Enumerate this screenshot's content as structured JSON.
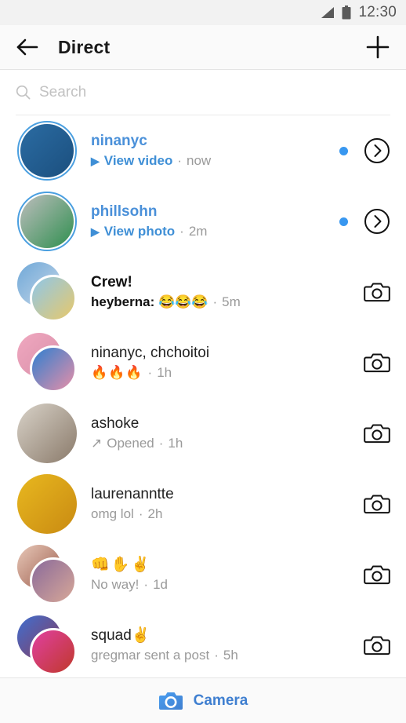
{
  "status_bar": {
    "time": "12:30",
    "signal_icon": "signal-triangle-icon",
    "battery_icon": "battery-icon"
  },
  "header": {
    "title": "Direct",
    "back_icon": "back-arrow-icon",
    "new_message_icon": "plus-icon"
  },
  "search": {
    "placeholder": "Search",
    "value": "",
    "icon": "search-icon"
  },
  "conversations": [
    {
      "name": "ninanyc",
      "name_style": "blue",
      "preview": "View video",
      "preview_style": "blue",
      "time": "now",
      "separator": "·",
      "media_icon": "play-triangle-icon",
      "avatar_type": "single-ring",
      "unread_dot": true,
      "action_icon": "chevron-right-circle-icon"
    },
    {
      "name": "phillsohn",
      "name_style": "blue",
      "preview": "View photo",
      "preview_style": "blue",
      "time": "2m",
      "separator": "·",
      "media_icon": "play-triangle-icon",
      "avatar_type": "single-ring",
      "unread_dot": true,
      "action_icon": "chevron-right-circle-icon"
    },
    {
      "name": "Crew!",
      "name_style": "unread",
      "preview": "heyberna: 😂😂😂",
      "preview_style": "unread",
      "time": "5m",
      "separator": "·",
      "avatar_type": "group",
      "unread_dot": false,
      "action_icon": "camera-outline-icon"
    },
    {
      "name": "ninanyc, chchoitoi",
      "name_style": "normal",
      "preview": "🔥🔥🔥",
      "preview_style": "emoji",
      "time": "1h",
      "separator": "·",
      "avatar_type": "group",
      "unread_dot": false,
      "action_icon": "camera-outline-icon"
    },
    {
      "name": "ashoke",
      "name_style": "normal",
      "preview": "Opened",
      "preview_style": "opened",
      "time": "1h",
      "separator": "·",
      "media_icon": "arrow-up-right-icon",
      "avatar_type": "single",
      "unread_dot": false,
      "action_icon": "camera-outline-icon"
    },
    {
      "name": "laurenanntte",
      "name_style": "normal",
      "preview": "omg lol",
      "preview_style": "normal",
      "time": "2h",
      "separator": "·",
      "avatar_type": "single",
      "unread_dot": false,
      "action_icon": "camera-outline-icon"
    },
    {
      "name": "👊✋✌️",
      "name_style": "emoji",
      "preview": "No way!",
      "preview_style": "normal",
      "time": "1d",
      "separator": "·",
      "avatar_type": "group",
      "unread_dot": false,
      "action_icon": "camera-outline-icon"
    },
    {
      "name": "squad✌️",
      "name_style": "normal",
      "preview": "gregmar sent a post",
      "preview_style": "normal",
      "time": "5h",
      "separator": "·",
      "avatar_type": "group",
      "unread_dot": false,
      "action_icon": "camera-outline-icon"
    }
  ],
  "bottom_bar": {
    "camera_label": "Camera",
    "camera_icon": "camera-filled-icon"
  },
  "colors": {
    "accent_blue": "#3897f0",
    "link_blue": "#4a90d9",
    "camera_blue": "#3f7fd0",
    "muted_gray": "#9a9a9a",
    "status_bar_bg": "#f2f2f2",
    "header_bg": "#fafafa"
  }
}
